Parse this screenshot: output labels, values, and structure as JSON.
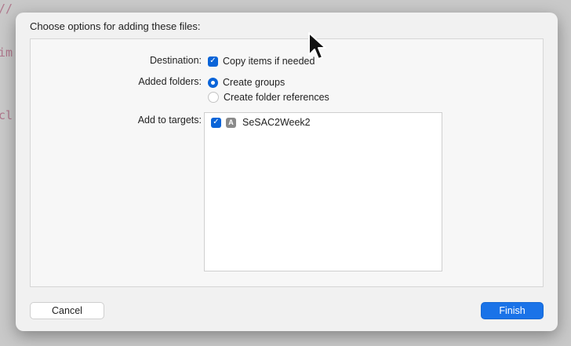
{
  "background_code": [
    "//",
    "im",
    "cl"
  ],
  "dialog": {
    "title": "Choose options for adding these files:",
    "destination": {
      "label": "Destination:",
      "option": "Copy items if needed",
      "checked": true
    },
    "added_folders": {
      "label": "Added folders:",
      "options": [
        {
          "label": "Create groups",
          "selected": true
        },
        {
          "label": "Create folder references",
          "selected": false
        }
      ]
    },
    "add_to_targets": {
      "label": "Add to targets:",
      "targets": [
        {
          "name": "SeSAC2Week2",
          "checked": true,
          "icon": "app-target-icon"
        }
      ]
    },
    "buttons": {
      "cancel": "Cancel",
      "finish": "Finish"
    }
  },
  "colors": {
    "accent": "#0a64d8",
    "finish_button": "#1a73e8"
  }
}
